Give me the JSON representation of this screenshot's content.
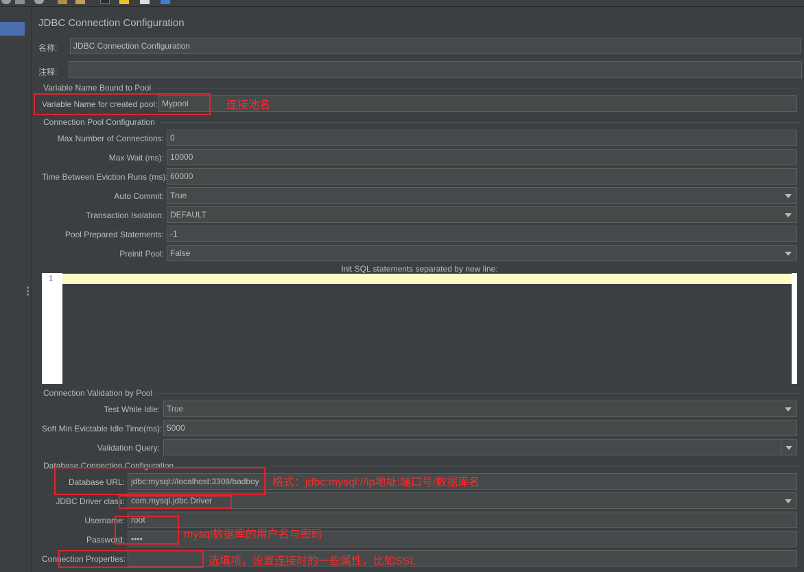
{
  "window": {
    "title": "JDBC Connection Configuration"
  },
  "name_row": {
    "label": "名称:",
    "value": "JDBC Connection Configuration"
  },
  "comment_row": {
    "label": "注释:",
    "value": ""
  },
  "sections": {
    "variable_bound": "Variable Name Bound to Pool",
    "pool_config": "Connection Pool Configuration",
    "validation": "Connection Validation by Pool",
    "database": "Database Connection Configuration"
  },
  "variable_pool": {
    "label": "Variable Name for created pool:",
    "value": "Mypool"
  },
  "pool": {
    "max_connections_label": "Max Number of Connections:",
    "max_connections_value": "0",
    "max_wait_label": "Max Wait (ms):",
    "max_wait_value": "10000",
    "eviction_label": "Time Between Eviction Runs (ms):",
    "eviction_value": "60000",
    "auto_commit_label": "Auto Commit:",
    "auto_commit_value": "True",
    "isolation_label": "Transaction Isolation:",
    "isolation_value": "DEFAULT",
    "prepared_label": "Pool Prepared Statements:",
    "prepared_value": "-1",
    "preinit_label": "Preinit Pool:",
    "preinit_value": "False",
    "init_sql_label": "Init SQL statements separated by new line:",
    "line_number": "1"
  },
  "validation": {
    "test_idle_label": "Test While Idle:",
    "test_idle_value": "True",
    "soft_min_label": "Soft Min Evictable Idle Time(ms):",
    "soft_min_value": "5000",
    "query_label": "Validation Query:",
    "query_value": ""
  },
  "database": {
    "url_label": "Database URL:",
    "url_value": "jdbc:mysql://localhost:3308/badboy",
    "driver_label": "JDBC Driver class:",
    "driver_value": "com.mysql.jdbc.Driver",
    "username_label": "Username:",
    "username_value": "root",
    "password_label": "Password:",
    "password_value": "••••",
    "props_label": "Connection Properties:",
    "props_value": ""
  },
  "annotations": {
    "pool_name": "连接池名",
    "url_format": "格式：jdbc:mysql://ip地址:端口号/数据库名",
    "credentials": "mysql数据库的用户名与密码",
    "properties": "选填项，设置连接时的一些属性，比如SSL"
  },
  "colors": {
    "background": "#3c3f41",
    "field_bg": "#45494a",
    "selection": "#4b6eaf",
    "annotation_red": "#e0242c",
    "editor_line_highlight": "#fdfbc3"
  },
  "icons": [
    "toolbar-icon",
    "dropdown-arrow-icon",
    "splitter-grip-icon"
  ]
}
